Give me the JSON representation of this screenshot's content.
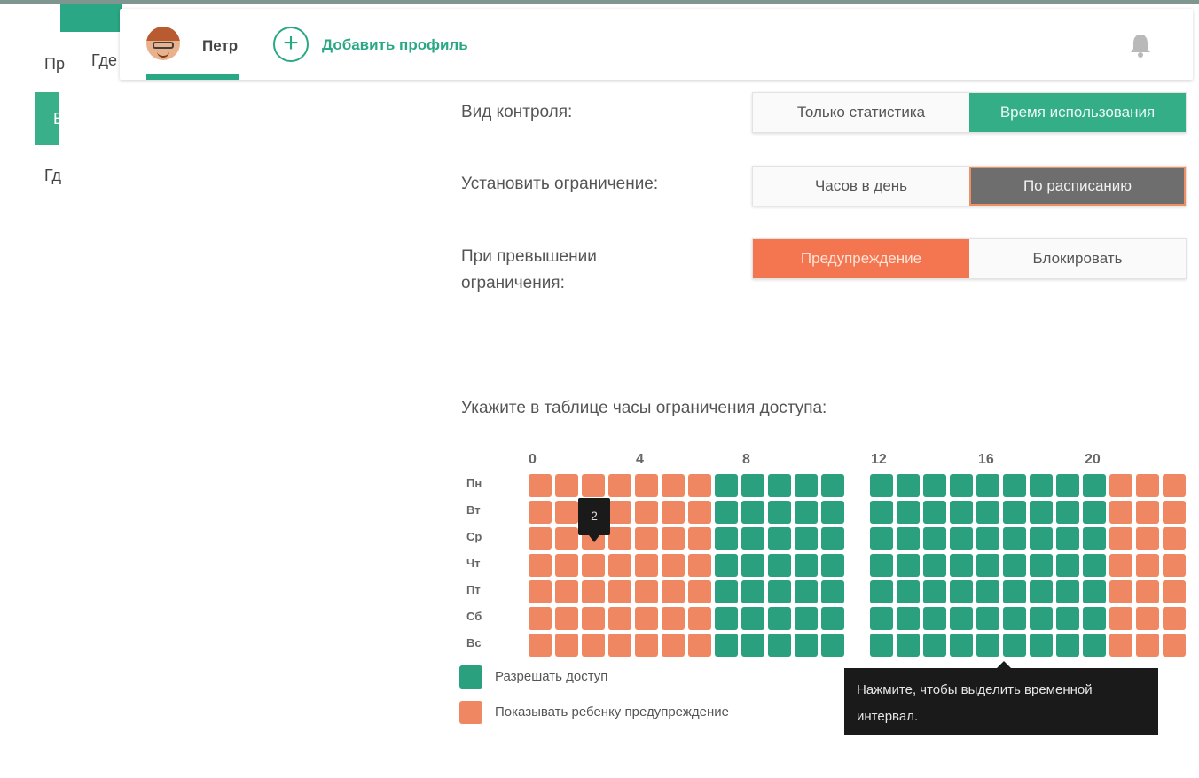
{
  "nav_behind": {
    "item1": "Пр",
    "item2": "Где",
    "item3": "Вр",
    "item4": "Гд"
  },
  "profile_bar": {
    "profile_name": "Петр",
    "add_profile_label": "Добавить профиль",
    "add_icon": "plus-circle-icon",
    "bell_icon": "bell-icon"
  },
  "settings": {
    "control_type": {
      "label": "Вид контроля:",
      "options": [
        "Только статистика",
        "Время использования"
      ],
      "selected": "Время использования"
    },
    "limit_type": {
      "label": "Установить ограничение:",
      "options": [
        "Часов в день",
        "По расписанию"
      ],
      "selected": "По расписанию"
    },
    "on_exceed": {
      "label_line1": "При превышении",
      "label_line2": "ограничения:",
      "options": [
        "Предупреждение",
        "Блокировать"
      ],
      "selected": "Предупреждение"
    }
  },
  "schedule": {
    "title": "Укажите в таблице часы ограничения доступа:",
    "hour_labels": [
      "0",
      "4",
      "8",
      "12",
      "16",
      "20"
    ],
    "days": [
      "Пн",
      "Вт",
      "Ср",
      "Чт",
      "Пт",
      "Сб",
      "Вс"
    ],
    "allowed_hours": "7-20",
    "hover_tooltip": "2",
    "legend": {
      "allow": "Разрешать доступ",
      "warn": "Показывать ребенку предупреждение"
    },
    "hint_line1": "Нажмите, чтобы выделить временной",
    "hint_line2": "интервал.",
    "colors": {
      "allow": "#2aa07e",
      "warn": "#ef8862"
    }
  }
}
